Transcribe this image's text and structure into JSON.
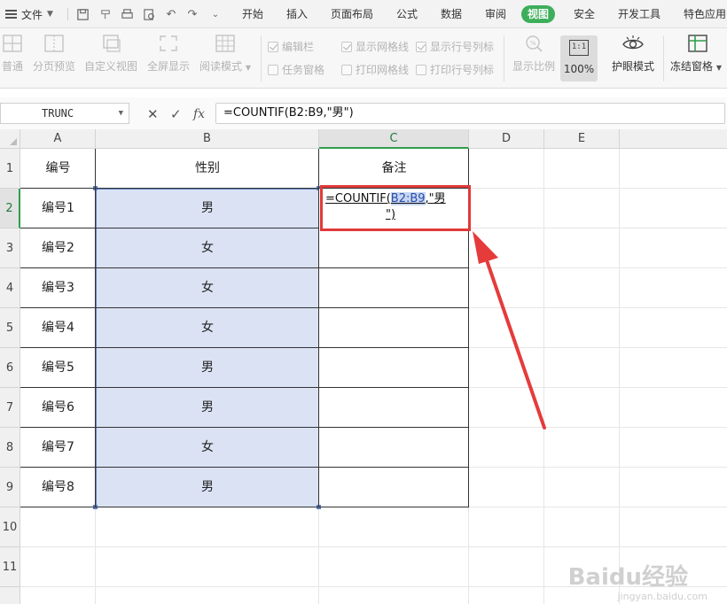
{
  "menubar": {
    "file_label": "文件",
    "tabs": [
      "开始",
      "插入",
      "页面布局",
      "公式",
      "数据",
      "审阅",
      "视图",
      "安全",
      "开发工具",
      "特色应用"
    ],
    "active_tab": "视图",
    "active_color": "#3dae5a"
  },
  "ribbon": {
    "buttons": [
      "普通",
      "分页预览",
      "自定义视图",
      "全屏显示",
      "阅读模式"
    ],
    "checkboxes": [
      {
        "label": "编辑栏",
        "checked": true
      },
      {
        "label": "显示网格线",
        "checked": true
      },
      {
        "label": "显示行号列标",
        "checked": true
      },
      {
        "label": "任务窗格",
        "checked": false
      },
      {
        "label": "打印网格线",
        "checked": false
      },
      {
        "label": "打印行号列标",
        "checked": false
      }
    ],
    "zoom_ratio_label": "显示比例",
    "zoom_icon_text": "1:1",
    "zoom_100_label": "100%",
    "eye_protect_label": "护眼模式",
    "freeze_label": "冻结窗格"
  },
  "formula_bar": {
    "name_box": "TRUNC",
    "fx_label": "fx",
    "formula": "=COUNTIF(B2:B9,\"男\")"
  },
  "sheet": {
    "columns": [
      "A",
      "B",
      "C",
      "D",
      "E"
    ],
    "rows": [
      "1",
      "2",
      "3",
      "4",
      "5",
      "6",
      "7",
      "8",
      "9",
      "10",
      "11"
    ],
    "header_row": {
      "a": "编号",
      "b": "性别",
      "c": "备注"
    },
    "data": [
      {
        "a": "编号1",
        "b": "男"
      },
      {
        "a": "编号2",
        "b": "女"
      },
      {
        "a": "编号3",
        "b": "女"
      },
      {
        "a": "编号4",
        "b": "女"
      },
      {
        "a": "编号5",
        "b": "男"
      },
      {
        "a": "编号6",
        "b": "男"
      },
      {
        "a": "编号7",
        "b": "女"
      },
      {
        "a": "编号8",
        "b": "男"
      }
    ],
    "editing_cell": {
      "part1": "=COUNTIF(",
      "ref": "B2:B9",
      "part2": ",\"男",
      "part3": "\")"
    },
    "selection_color": "#cbd6f0",
    "highlight_color": "#e03a3a"
  },
  "watermark": {
    "brand": "Baidu经验",
    "url": "jingyan.baidu.com"
  }
}
